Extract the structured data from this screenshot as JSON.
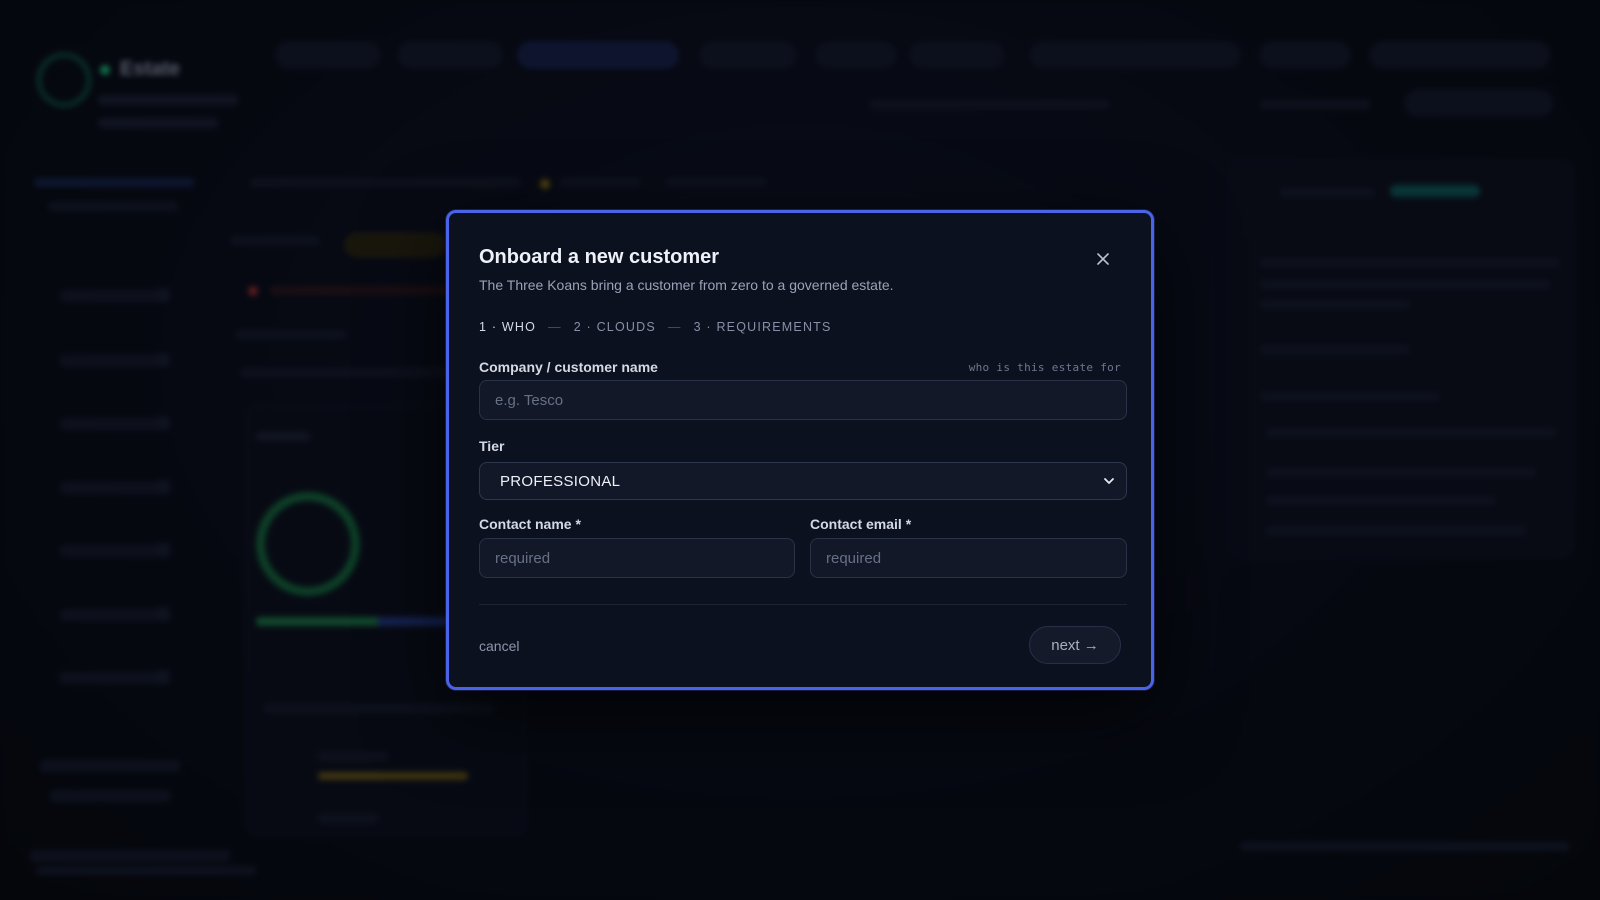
{
  "modal": {
    "title": "Onboard a new customer",
    "subtitle": "The Three Koans bring a customer from zero to a governed estate.",
    "close_icon": "close-icon",
    "steps": [
      {
        "label": "1 · WHO",
        "active": true
      },
      {
        "label": "2 · CLOUDS",
        "active": false
      },
      {
        "label": "3 · REQUIREMENTS",
        "active": false
      }
    ],
    "step_separator": "—",
    "company": {
      "label": "Company / customer name",
      "hint": "who is this estate for",
      "placeholder": "e.g. Tesco",
      "value": ""
    },
    "tier": {
      "label": "Tier",
      "selected": "PROFESSIONAL",
      "icon": "chevron-down-icon"
    },
    "contact_name": {
      "label": "Contact name *",
      "placeholder": "required",
      "value": ""
    },
    "contact_email": {
      "label": "Contact email *",
      "placeholder": "required",
      "value": ""
    },
    "cancel_label": "cancel",
    "next_label": "next →"
  },
  "background": {
    "brand": "Estate"
  },
  "colors": {
    "accent_border": "#4a63e8",
    "modal_bg": "#0c111f",
    "input_bg": "#121827"
  }
}
